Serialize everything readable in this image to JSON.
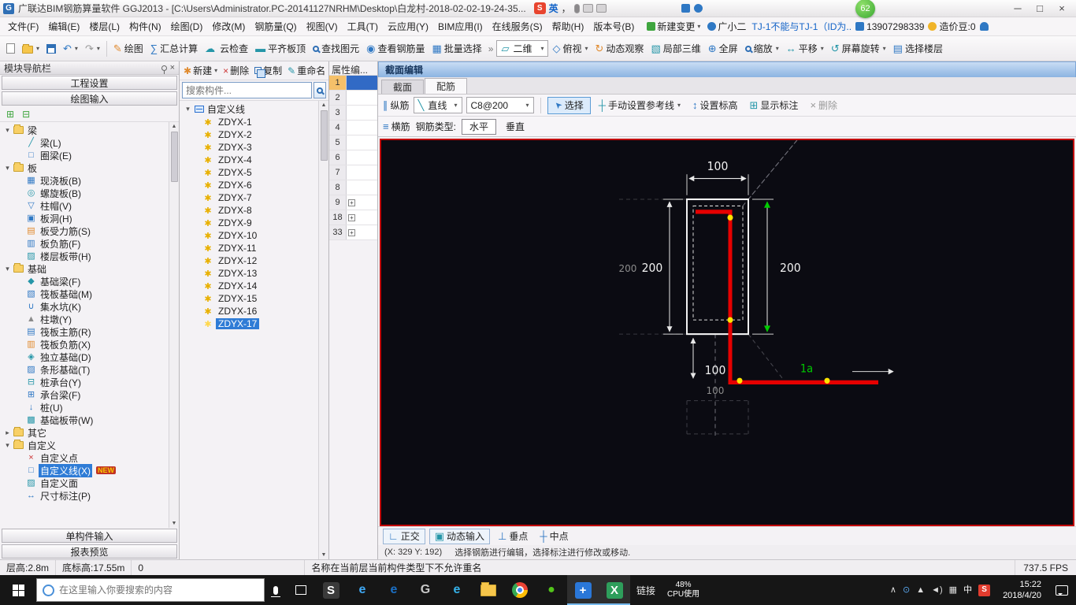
{
  "ui_colors": {
    "selection": "#2f7cd6",
    "canvas_border": "#c00000",
    "rebar_red": "#e60000",
    "handle_yellow": "#ffe400",
    "dim_label_green": "#00cc00"
  },
  "titlebar": {
    "title": "广联达BIM钢筋算量软件 GGJ2013 - [C:\\Users\\Administrator.PC-20141127NRHM\\Desktop\\白龙村-2018-02-02-19-24-35...",
    "lang_indicator": "英",
    "punct_indicator": "，",
    "badge_count": "62"
  },
  "menubar": {
    "items": [
      "文件(F)",
      "编辑(E)",
      "楼层(L)",
      "构件(N)",
      "绘图(D)",
      "修改(M)",
      "钢筋量(Q)",
      "视图(V)",
      "工具(T)",
      "云应用(Y)",
      "BIM应用(I)",
      "在线服务(S)",
      "帮助(H)",
      "版本号(B)"
    ],
    "new_change": "新建变更",
    "assistant": "广小二",
    "notice": "TJ-1不能与TJ-1（ID为..",
    "phone": "13907298339",
    "beans": "造价豆:0"
  },
  "toolbar": {
    "draw": "绘图",
    "summary": "汇总计算",
    "cloud_check": "云检查",
    "align_top": "平齐板顶",
    "find": "查找图元",
    "view_rebar": "查看钢筋量",
    "batch_select": "批量选择",
    "view_mode": "二维",
    "top_view": "俯视",
    "orbit": "动态观察",
    "partial_3d": "局部三维",
    "full": "全屏",
    "zoom": "缩放",
    "pan": "平移",
    "rotate": "屏幕旋转",
    "floor": "选择楼层"
  },
  "left_nav": {
    "title": "模块导航栏",
    "settings_btn": "工程设置",
    "draw_btn": "绘图输入",
    "tree": [
      {
        "folder": true,
        "label": "梁"
      },
      {
        "label": "梁(L)",
        "g": "╱",
        "c": "#2596a8"
      },
      {
        "label": "圈梁(E)",
        "g": "□",
        "c": "#2f78c4"
      },
      {
        "folder": true,
        "label": "板"
      },
      {
        "label": "现浇板(B)",
        "g": "▦",
        "c": "#2f78c4"
      },
      {
        "label": "螺旋板(B)",
        "g": "◎",
        "c": "#2596a8"
      },
      {
        "label": "柱帽(V)",
        "g": "▽",
        "c": "#2f78c4"
      },
      {
        "label": "板洞(H)",
        "g": "▣",
        "c": "#2f78c4"
      },
      {
        "label": "板受力筋(S)",
        "g": "▤",
        "c": "#e08a2e"
      },
      {
        "label": "板负筋(F)",
        "g": "▥",
        "c": "#2f78c4"
      },
      {
        "label": "楼层板带(H)",
        "g": "▨",
        "c": "#2596a8"
      },
      {
        "folder": true,
        "label": "基础"
      },
      {
        "label": "基础梁(F)",
        "g": "◆",
        "c": "#2596a8"
      },
      {
        "label": "筏板基础(M)",
        "g": "▧",
        "c": "#2f78c4"
      },
      {
        "label": "集水坑(K)",
        "g": "∪",
        "c": "#2f78c4"
      },
      {
        "label": "柱墩(Y)",
        "g": "▲",
        "c": "#8a8a8a"
      },
      {
        "label": "筏板主筋(R)",
        "g": "▤",
        "c": "#2f78c4"
      },
      {
        "label": "筏板负筋(X)",
        "g": "▥",
        "c": "#e08a2e"
      },
      {
        "label": "独立基础(D)",
        "g": "◈",
        "c": "#2596a8"
      },
      {
        "label": "条形基础(T)",
        "g": "▨",
        "c": "#2f78c4"
      },
      {
        "label": "桩承台(Y)",
        "g": "⊟",
        "c": "#2596a8"
      },
      {
        "label": "承台梁(F)",
        "g": "⊞",
        "c": "#2f78c4"
      },
      {
        "label": "桩(U)",
        "g": "↓",
        "c": "#2f78c4"
      },
      {
        "label": "基础板带(W)",
        "g": "▩",
        "c": "#2596a8"
      },
      {
        "folder": true,
        "collapsed": true,
        "label": "其它"
      },
      {
        "folder": true,
        "label": "自定义"
      },
      {
        "label": "自定义点",
        "g": "×",
        "c": "#cc3333"
      },
      {
        "label": "自定义线(X)",
        "g": "□",
        "c": "#2f78c4",
        "sel": true,
        "badge": "NEW"
      },
      {
        "label": "自定义面",
        "g": "▨",
        "c": "#2596a8"
      },
      {
        "label": "尺寸标注(P)",
        "g": "↔",
        "c": "#2f78c4"
      }
    ],
    "input_btn": "单构件输入",
    "report_btn": "报表预览"
  },
  "component_panel": {
    "new_btn": "新建",
    "del_btn": "删除",
    "copy_btn": "复制",
    "rename_btn": "重命名",
    "search_placeholder": "搜索构件...",
    "group": "自定义线",
    "items": [
      "ZDYX-1",
      "ZDYX-2",
      "ZDYX-3",
      "ZDYX-4",
      "ZDYX-5",
      "ZDYX-6",
      "ZDYX-7",
      "ZDYX-8",
      "ZDYX-9",
      "ZDYX-10",
      "ZDYX-11",
      "ZDYX-12",
      "ZDYX-13",
      "ZDYX-14",
      "ZDYX-15",
      "ZDYX-16",
      "ZDYX-17"
    ],
    "selected": "ZDYX-17"
  },
  "properties": {
    "title": "属性编...",
    "rows": [
      {
        "n": "1",
        "sel": true
      },
      {
        "n": "2"
      },
      {
        "n": "3"
      },
      {
        "n": "4"
      },
      {
        "n": "5"
      },
      {
        "n": "6"
      },
      {
        "n": "7"
      },
      {
        "n": "8"
      },
      {
        "n": "9",
        "plus": true
      },
      {
        "n": "18",
        "plus": true
      },
      {
        "n": "33",
        "plus": true
      }
    ]
  },
  "section_editor": {
    "panel_title": "截面编辑",
    "tabs": [
      "截面",
      "配筋"
    ],
    "active_tab": "配筋",
    "longitudinal": "纵筋",
    "line_combo": "直线",
    "spec_combo": "C8@200",
    "select_btn": "选择",
    "ref_line_btn": "手动设置参考线",
    "set_elevation": "设置标高",
    "show_annotation": "显示标注",
    "delete_btn": "删除",
    "transverse": "横筋",
    "rebar_type_label": "钢筋类型:",
    "horizontal": "水平",
    "vertical": "垂直",
    "ortho": "正交",
    "dynamic_input": "动态输入",
    "perp_point": "垂点",
    "mid_point": "中点",
    "coords": "(X: 329 Y: 192)",
    "hint": "选择钢筋进行编辑，选择标注进行修改或移动.",
    "canvas": {
      "dim_top": "100",
      "dim_left_gray": "200",
      "dim_left": "200",
      "dim_right": "200",
      "dim_bottom": "100",
      "dim_bottom_gray": "100",
      "rebar_label": "1a"
    }
  },
  "statusbar": {
    "floor_height": "层高:2.8m",
    "bottom_elev": "底标高:17.55m",
    "zero": "0",
    "message": "名称在当前层当前构件类型下不允许重名",
    "fps": "737.5 FPS"
  },
  "taskbar": {
    "search_placeholder": "在这里输入你要搜索的内容",
    "link_label": "链接",
    "cpu_pct": "48%",
    "cpu_label": "CPU使用",
    "time": "15:22",
    "date": "2018/4/20",
    "apps": [
      {
        "name": "sogou-input",
        "g": "S",
        "bg": "#3a3a3a",
        "fg": "#fff"
      },
      {
        "name": "ie",
        "g": "e",
        "fg": "#3fa9f5"
      },
      {
        "name": "browser",
        "g": "e",
        "fg": "#1b6fc4"
      },
      {
        "name": "g-assistant",
        "g": "G",
        "fg": "#c9c9c9"
      },
      {
        "name": "edge",
        "g": "e",
        "fg": "#35b1e8"
      },
      {
        "name": "explorer",
        "type": "folder"
      },
      {
        "name": "chrome",
        "type": "chrome"
      },
      {
        "name": "360-browser",
        "g": "●",
        "fg": "#52c41a"
      },
      {
        "name": "glodon",
        "g": "+",
        "bg": "#2a77d8",
        "fg": "#fff",
        "active": true
      },
      {
        "name": "wps",
        "g": "X",
        "bg": "#2e9e5b",
        "fg": "#fff",
        "active": true
      }
    ],
    "tray": [
      {
        "name": "chevron-up-icon",
        "g": "∧",
        "c": "#ddd"
      },
      {
        "name": "safety-icon",
        "g": "⊙",
        "c": "#5aa8f0"
      },
      {
        "name": "wifi-icon",
        "g": "▲",
        "c": "#ddd"
      },
      {
        "name": "volume-icon",
        "g": "◄)",
        "c": "#ddd"
      },
      {
        "name": "keyboard-icon",
        "g": "▦",
        "c": "#ddd"
      },
      {
        "name": "ime-indicator",
        "g": "中",
        "c": "#fff"
      },
      {
        "name": "sogou-tray-icon",
        "g": "S",
        "bg": "#e23c2e",
        "c": "#fff"
      }
    ]
  }
}
